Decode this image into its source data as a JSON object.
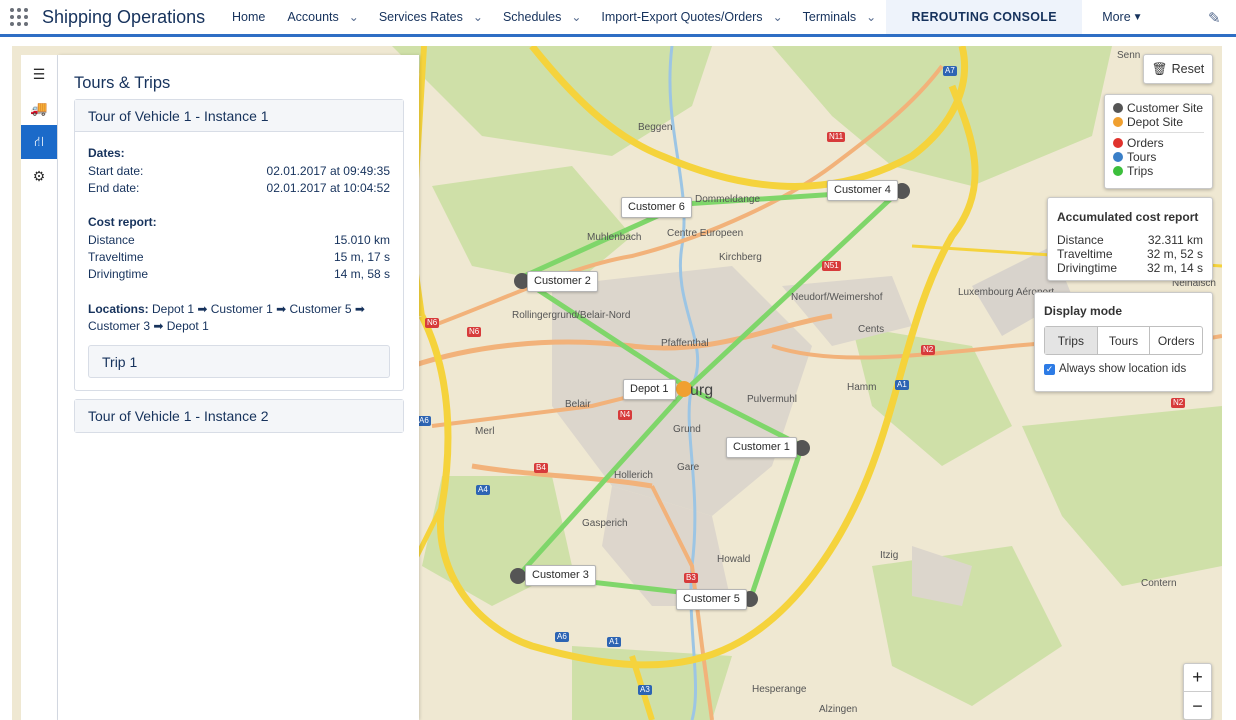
{
  "app": {
    "name": "Shipping Operations"
  },
  "nav": {
    "items": [
      {
        "label": "Home",
        "chevron": false
      },
      {
        "label": "Accounts",
        "chevron": true
      },
      {
        "label": "Services Rates",
        "chevron": true
      },
      {
        "label": "Schedules",
        "chevron": true
      },
      {
        "label": "Import-Export Quotes/Orders",
        "chevron": true
      },
      {
        "label": "Terminals",
        "chevron": true
      }
    ],
    "active": "REROUTING CONSOLE",
    "more": "More"
  },
  "panel": {
    "title": "Tours & Trips",
    "tour1": {
      "header": "Tour of Vehicle 1 - Instance 1",
      "dates_title": "Dates:",
      "start_label": "Start date:",
      "start_value": "02.01.2017 at 09:49:35",
      "end_label": "End date:",
      "end_value": "02.01.2017 at 10:04:52",
      "cost_title": "Cost report:",
      "distance_label": "Distance",
      "distance_value": "15.010 km",
      "traveltime_label": "Traveltime",
      "traveltime_value": "15 m, 17 s",
      "drivingtime_label": "Drivingtime",
      "drivingtime_value": "14 m, 58 s",
      "locations_label": "Locations:",
      "locations_line1": "Depot 1 ➡ Customer 1 ➡ Customer 5 ➡",
      "locations_line2": "Customer 3 ➡ Depot 1",
      "trip": "Trip 1"
    },
    "tour2": {
      "header": "Tour of Vehicle 1 - Instance 2"
    }
  },
  "map": {
    "reset": "Reset",
    "legend": {
      "customer_site": "Customer Site",
      "depot_site": "Depot Site",
      "orders": "Orders",
      "tours": "Tours",
      "trips": "Trips",
      "colors": {
        "customer": "#555555",
        "depot": "#f0a030",
        "orders": "#e0322d",
        "tours": "#3a7fc8",
        "trips": "#3cbf3c"
      }
    },
    "cost_report": {
      "title": "Accumulated cost report",
      "distance_label": "Distance",
      "distance_value": "32.311 km",
      "traveltime_label": "Traveltime",
      "traveltime_value": "32 m, 52 s",
      "drivingtime_label": "Drivingtime",
      "drivingtime_value": "32 m, 14 s"
    },
    "display_mode": {
      "title": "Display mode",
      "options": [
        "Trips",
        "Tours",
        "Orders"
      ],
      "selected": "Trips",
      "checkbox_label": "Always show location ids",
      "checked": true
    },
    "zoom": {
      "in": "+",
      "out": "−"
    },
    "locations": {
      "customer6": "Customer 6",
      "customer4": "Customer 4",
      "customer2": "Customer 2",
      "depot1": "Depot 1",
      "customer1": "Customer 1",
      "customer3": "Customer 3",
      "customer5": "Customer 5"
    },
    "towns": {
      "beggen": "Beggen",
      "dommeldange": "Dommeldange",
      "centre_europeen": "Centre Europeen",
      "muhlenbach": "Muhlenbach",
      "kirchberg": "Kirchberg",
      "neudorf": "Neudorf/Weimershof",
      "rollingergrund": "Rollingergrund/Belair-Nord",
      "pfaffenthal": "Pfaffenthal",
      "cents": "Cents",
      "luxembourg_airport": "Luxembourg Aéroport",
      "burg": "urg",
      "hamm": "Hamm",
      "belair": "Belair",
      "pulvermuhl": "Pulvermuhl",
      "merl": "Merl",
      "grund": "Grund",
      "gare": "Gare",
      "hollerich": "Hollerich",
      "gasperich": "Gasperich",
      "howald": "Howald",
      "itzig": "Itzig",
      "contern": "Contern",
      "hesperange": "Hesperange",
      "alzingen": "Alzingen",
      "senningen": "Senn",
      "neihaisch": "Neihaisch"
    },
    "roads": [
      "A7",
      "N11",
      "N51",
      "N6",
      "N6",
      "N4",
      "N2",
      "A1",
      "A6",
      "B4",
      "A4",
      "B3",
      "A6",
      "A1",
      "A3",
      "N2"
    ]
  }
}
